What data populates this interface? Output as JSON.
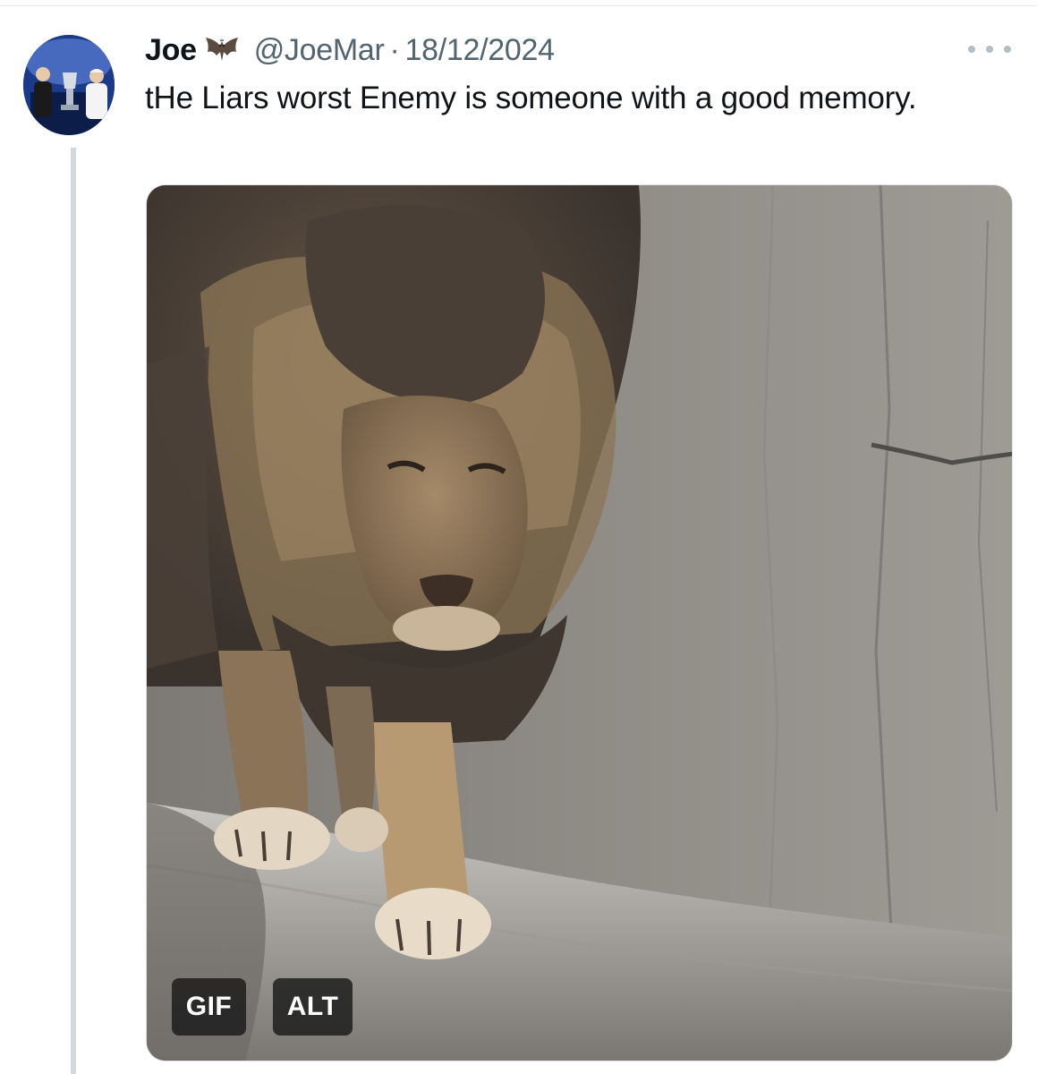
{
  "tweet": {
    "author": {
      "display_name": "Joe",
      "badge_emoji": "bat-icon",
      "handle": "@JoeMar",
      "separator": "·",
      "date": "18/12/2024"
    },
    "text": "tHe Liars worst Enemy is someone with a good memory.",
    "media": {
      "type": "gif",
      "subject": "lion-walking-gif",
      "gif_label": "GIF",
      "alt_label": "ALT"
    },
    "more_menu": "more-icon"
  },
  "colors": {
    "text_primary": "#0f1419",
    "text_secondary": "#536471",
    "thread_line": "#cfd9de",
    "badge_bg": "#1a1a1a"
  }
}
